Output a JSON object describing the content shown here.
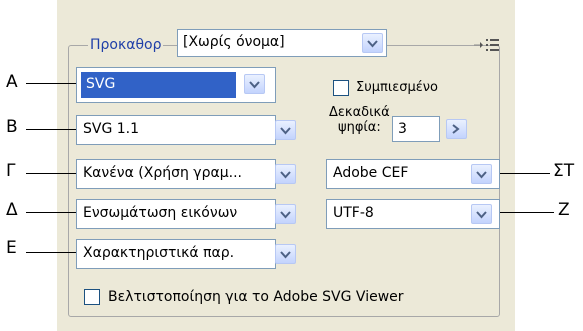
{
  "callouts": {
    "a": "A",
    "b": "B",
    "g": "Γ",
    "d": "Δ",
    "e": "E",
    "st": "ΣΤ",
    "z": "Z"
  },
  "preset": {
    "label": "Προκαθορ",
    "value": "[Χωρίς όνομα]"
  },
  "format": {
    "value": "SVG"
  },
  "compressed": {
    "label": "Συμπιεσμένο",
    "checked": false
  },
  "decimals": {
    "label_line1": "Δεκαδικά",
    "label_line2": "ψηφία:",
    "value": "3"
  },
  "dtd": {
    "value": "SVG 1.1"
  },
  "font_subset": {
    "value": "Κανένα (Χρήση γραμ..."
  },
  "images": {
    "value": "Ενσωμάτωση εικόνων"
  },
  "attributes": {
    "value": "Χαρακτηριστικά παρ."
  },
  "font_location": {
    "value": "Adobe CEF"
  },
  "encoding": {
    "value": "UTF-8"
  },
  "optimize": {
    "label": "Βελτιστοποίηση για το Adobe SVG Viewer",
    "checked": false
  }
}
